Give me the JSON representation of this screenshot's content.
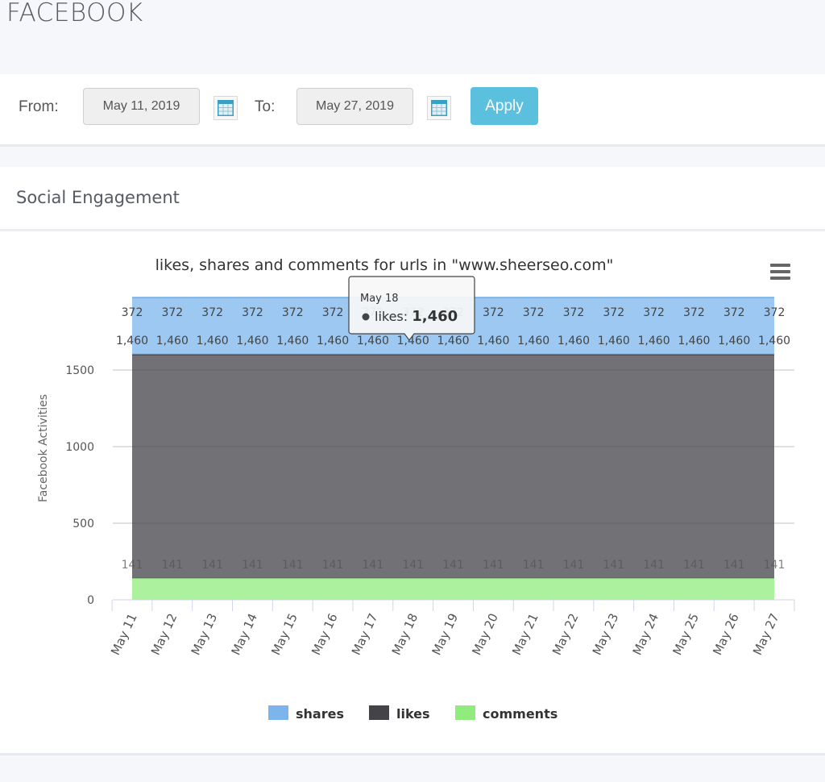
{
  "page": {
    "title": "FACEBOOK"
  },
  "filters": {
    "from_label": "From:",
    "from_value": "May 11, 2019",
    "to_label": "To:",
    "to_value": "May 27, 2019",
    "calendar_icon": "calendar-icon",
    "apply_label": "Apply",
    "apply_color": "#5bc0de"
  },
  "panel": {
    "title": "Social Engagement",
    "menu_icon": "hamburger-menu-icon"
  },
  "tooltip": {
    "date": "May 18",
    "series": "likes",
    "label": "likes: ",
    "value": "1,460"
  },
  "chart_data": {
    "type": "area",
    "stacked": true,
    "title": "likes, shares and comments for urls in \"www.sheerseo.com\"",
    "xlabel": "",
    "ylabel": "Facebook Activities",
    "ylim": [
      0,
      2000
    ],
    "yticks": [
      0,
      500,
      1000,
      1500
    ],
    "ytick_labels": [
      "0",
      "500",
      "1000",
      "1500"
    ],
    "grid": true,
    "legend_position": "bottom-center",
    "categories": [
      "May 11",
      "May 12",
      "May 13",
      "May 14",
      "May 15",
      "May 16",
      "May 17",
      "May 18",
      "May 19",
      "May 20",
      "May 21",
      "May 22",
      "May 23",
      "May 24",
      "May 25",
      "May 26",
      "May 27"
    ],
    "series": [
      {
        "name": "shares",
        "color": "#7cb5ec",
        "values": [
          372,
          372,
          372,
          372,
          372,
          372,
          372,
          372,
          372,
          372,
          372,
          372,
          372,
          372,
          372,
          372,
          372
        ],
        "labels": [
          "372",
          "372",
          "372",
          "372",
          "372",
          "372",
          "372",
          "372",
          "372",
          "372",
          "372",
          "372",
          "372",
          "372",
          "372",
          "372",
          "372"
        ]
      },
      {
        "name": "likes",
        "color": "#434348",
        "values": [
          1460,
          1460,
          1460,
          1460,
          1460,
          1460,
          1460,
          1460,
          1460,
          1460,
          1460,
          1460,
          1460,
          1460,
          1460,
          1460,
          1460
        ],
        "labels": [
          "1,460",
          "1,460",
          "1,460",
          "1,460",
          "1,460",
          "1,460",
          "1,460",
          "1,460",
          "1,460",
          "1,460",
          "1,460",
          "1,460",
          "1,460",
          "1,460",
          "1,460",
          "1,460",
          "1,460"
        ]
      },
      {
        "name": "comments",
        "color": "#90ed7d",
        "values": [
          141,
          141,
          141,
          141,
          141,
          141,
          141,
          141,
          141,
          141,
          141,
          141,
          141,
          141,
          141,
          141,
          141
        ],
        "labels": [
          "141",
          "141",
          "141",
          "141",
          "141",
          "141",
          "141",
          "141",
          "141",
          "141",
          "141",
          "141",
          "141",
          "141",
          "141",
          "141",
          "141"
        ]
      }
    ]
  }
}
